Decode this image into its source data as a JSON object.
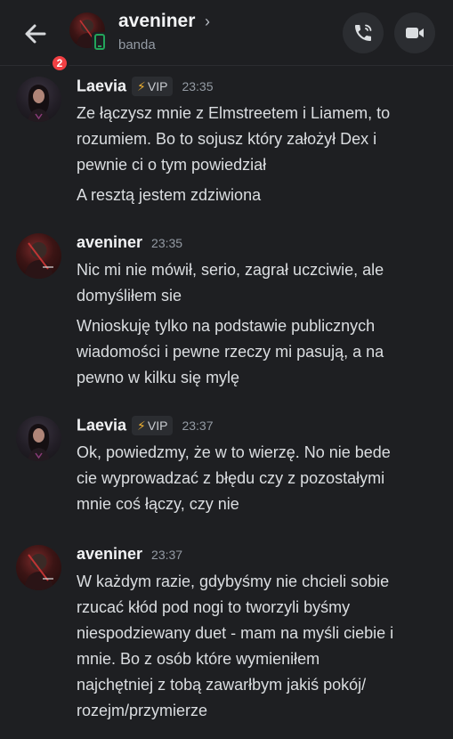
{
  "header": {
    "name": "aveniner",
    "chevron": "›",
    "subtitle": "banda",
    "unread_badge": "2",
    "back_icon": "arrow-left-icon",
    "call_icon": "phone-icon",
    "video_icon": "video-camera-icon",
    "status_icon": "mobile-phone-icon",
    "status_color": "#23a55a"
  },
  "vip_label": "VIP",
  "vip_icon": "lightning-bolt-icon",
  "messages": [
    {
      "author": "Laevia",
      "vip": true,
      "time": "23:35",
      "lines": [
        "Ze łączysz mnie z Elmstreetem i Liamem, to",
        "rozumiem. Bo to sojusz który założył Dex i",
        "pewnie ci o tym powiedział",
        "A resztą jestem zdziwiona"
      ]
    },
    {
      "author": "aveniner",
      "vip": false,
      "time": "23:35",
      "lines": [
        "Nic mi nie mówił, serio, zagrał uczciwie, ale",
        "domyśliłem sie",
        "Wnioskuję tylko na podstawie publicznych",
        "wiadomości i pewne rzeczy mi pasują, a na",
        "pewno w kilku się mylę"
      ]
    },
    {
      "author": "Laevia",
      "vip": true,
      "time": "23:37",
      "lines": [
        "Ok, powiedzmy, że w to wierzę. No nie bede",
        "cie wyprowadzać z błędu czy z pozostałymi",
        "mnie coś łączy, czy nie"
      ]
    },
    {
      "author": "aveniner",
      "vip": false,
      "time": "23:37",
      "lines": [
        "W każdym razie, gdybyśmy nie chcieli sobie",
        "rzucać kłód pod nogi to tworzyli byśmy",
        "niespodziewany duet - mam na myśli ciebie i",
        "mnie. Bo z osób które wymieniłem",
        "najchętniej z tobą zawarłbym jakiś pokój/",
        "rozejm/przymierze"
      ]
    }
  ]
}
